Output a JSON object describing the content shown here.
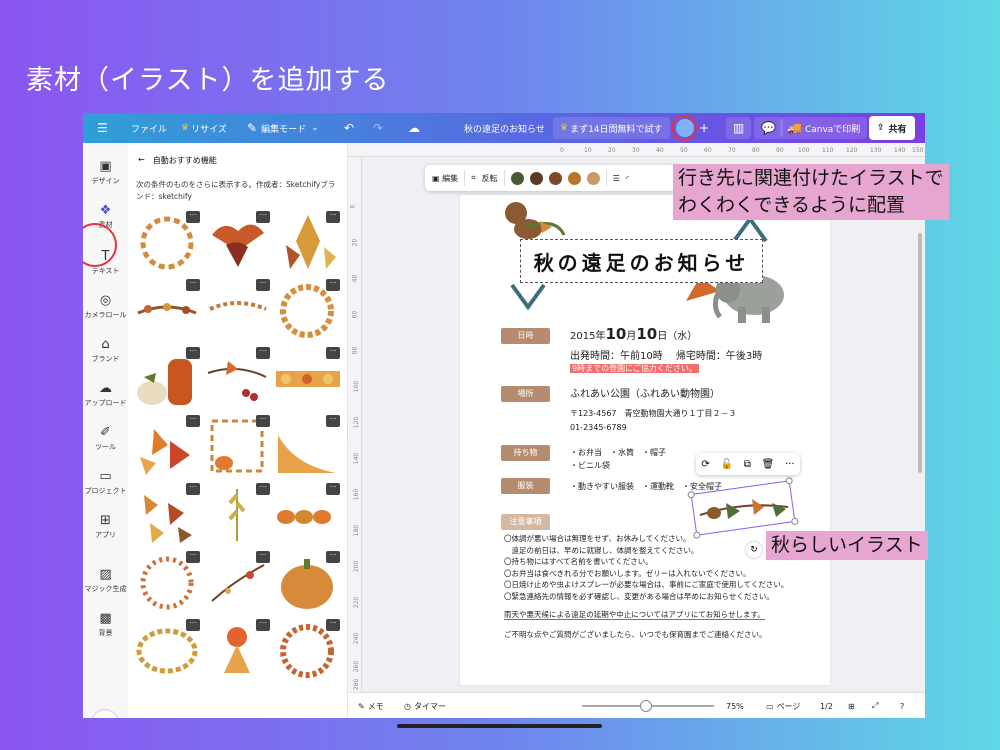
{
  "slide_title": "素材（イラスト）を追加する",
  "topbar": {
    "file": "ファイル",
    "resize": "リサイズ",
    "edit_mode": "編集モード",
    "doc_title": "秋の遠足のお知らせ",
    "trial": "まず14日間無料で試す",
    "print": "Canvaで印刷",
    "share": "共有"
  },
  "rail": {
    "design": "デザイン",
    "elements": "素材",
    "text": "テキスト",
    "camera_roll": "カメラロール",
    "brand": "ブランド",
    "uploads": "アップロード",
    "tools": "ツール",
    "projects": "プロジェクト",
    "apps": "アプリ",
    "magic": "マジック生成",
    "background": "背景"
  },
  "panel": {
    "heading": "自動おすすめ機能",
    "description": "次の条件のものをさらに表示する。作成者：Sketchifyブランド：sketchify"
  },
  "float_toolbar": {
    "edit": "編集",
    "flip": "反転",
    "swatches": [
      "#4c5a33",
      "#5a3a22",
      "#7a4a2a",
      "#b7752c",
      "#c99a66"
    ]
  },
  "ruler": {
    "top": [
      "0",
      "10",
      "20",
      "30",
      "40",
      "50",
      "60",
      "70",
      "80",
      "90",
      "100",
      "110",
      "120",
      "130",
      "140",
      "150"
    ],
    "left": [
      "0",
      "20",
      "40",
      "60",
      "80",
      "100",
      "120",
      "140",
      "160",
      "180",
      "200",
      "220",
      "240",
      "260",
      "280"
    ]
  },
  "doc": {
    "title": "秋の遠足のお知らせ",
    "label_date": "日時",
    "date_prefix": "2015年",
    "date_month": "10",
    "date_month_suffix": "月",
    "date_day": "10",
    "date_day_suffix": "日（水）",
    "time_line": "出発時間：午前10時　 帰宅時間：午後3時",
    "time_note": "9時までの登園にご協力ください。",
    "label_place": "場所",
    "place_name": "ふれあい公園（ふれあい動物園）",
    "place_address": "〒123-4567　青空動物園大通り１丁目２－３",
    "place_tel": "01-2345-6789",
    "label_items": "持ち物",
    "items_line1": "・お弁当　・水筒　・帽子",
    "items_line2": "・ビニル袋",
    "label_clothes": "服装",
    "clothes_line": "・動きやすい服装　・運動靴　・安全帽子",
    "label_notes": "注意事項",
    "notes": [
      "〇体調が悪い場合は無理をせず、お休みしてください。",
      "　遠足の前日は、早めに就寝し、体調を整えてください。",
      "〇持ち物にはすべて名前を書いてください。",
      "〇お弁当は食べきれる分でお願いします。ゼリーは入れないでください。",
      "〇日焼け止めや虫よけスプレーが必要な場合は、事前にご家庭で使用してください。",
      "〇緊急連絡先の情報を必ず確認し、変更がある場合は早めにお知らせください。"
    ],
    "rain_notice": "雨天や悪天候による遠足の延期や中止についてはアプリにてお知らせします。",
    "contact": "ご不明な点やご質問がございましたら、いつでも保育園までご連絡ください。"
  },
  "bottombar": {
    "memo": "メモ",
    "timer": "タイマー",
    "zoom": "75%",
    "pages": "ページ",
    "page_count": "1/2"
  },
  "callouts": {
    "top_line1": "行き先に関連付けたイラストで",
    "top_line2": "わくわくできるように配置",
    "bottom": "秋らしいイラスト"
  }
}
